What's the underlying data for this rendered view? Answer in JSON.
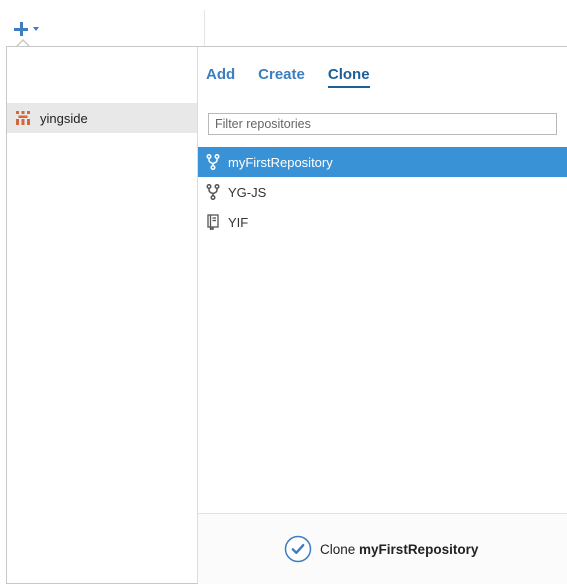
{
  "header": {
    "add_menu_icon": "plus-icon",
    "add_menu_caret": "chevron-down-icon",
    "accent_color": "#3c7ebf"
  },
  "tabs": [
    {
      "label": "Add",
      "active": false
    },
    {
      "label": "Create",
      "active": false
    },
    {
      "label": "Clone",
      "active": true
    }
  ],
  "accounts": [
    {
      "label": "yingside",
      "icon": "organization-icon",
      "selected": true
    }
  ],
  "filter": {
    "placeholder": "Filter repositories",
    "value": ""
  },
  "repositories": [
    {
      "name": "myFirstRepository",
      "icon": "fork-icon",
      "selected": true
    },
    {
      "name": "YG-JS",
      "icon": "fork-icon",
      "selected": false
    },
    {
      "name": "YIF",
      "icon": "book-icon",
      "selected": false
    }
  ],
  "footer": {
    "action_prefix": "Clone",
    "action_target": "myFirstRepository",
    "icon": "check-circle-icon"
  },
  "colors": {
    "selection": "#3a92d6",
    "account_selected_bg": "#e8e8e8",
    "org_icon": "#d2693c"
  }
}
